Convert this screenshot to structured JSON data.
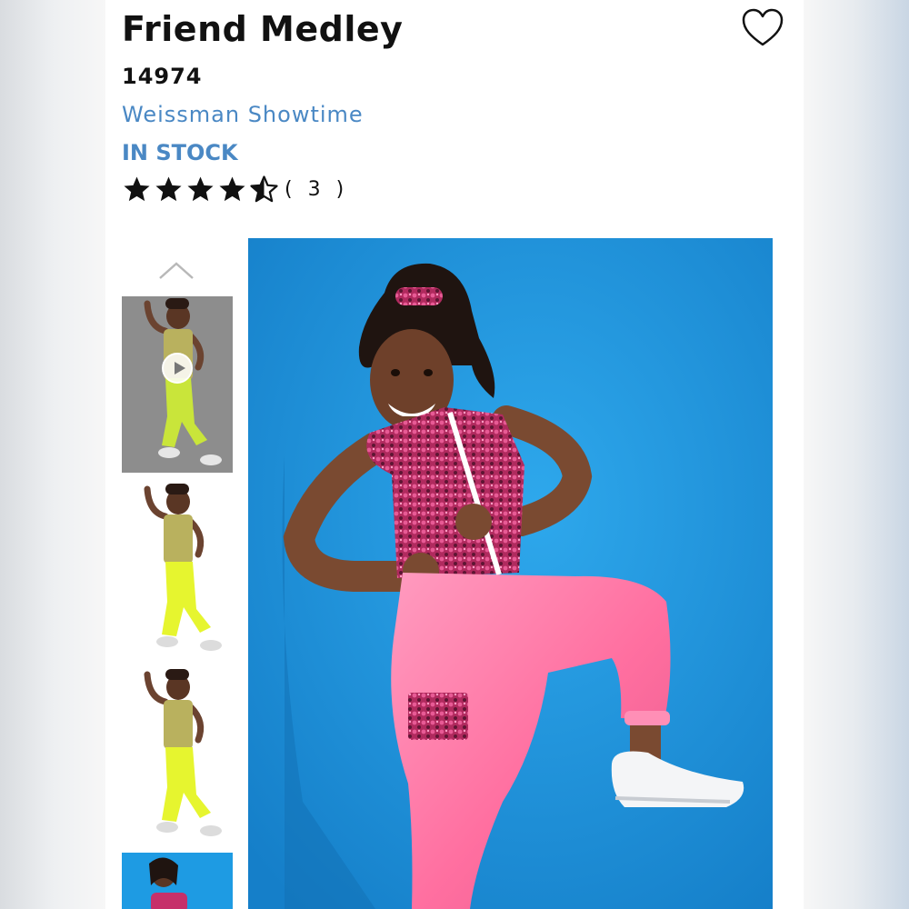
{
  "product": {
    "title": "Friend Medley",
    "sku": "14974",
    "brand": "Weissman Showtime",
    "stock_status": "IN STOCK",
    "rating": 4.5,
    "rating_max": 5,
    "review_count": "( 3 )"
  },
  "icons": {
    "favorite": "heart-outline-icon",
    "gallery_up": "chevron-up-icon",
    "video": "play-icon",
    "star": "star-icon"
  },
  "gallery": {
    "thumbnails": [
      {
        "kind": "video",
        "background": "#8d8d8d",
        "top": "#b9b15e",
        "pants": "#c9e53a"
      },
      {
        "kind": "image",
        "background": "#ffffff",
        "top": "#b9b15e",
        "pants": "#e6f52f"
      },
      {
        "kind": "image",
        "background": "#ffffff",
        "top": "#b9b15e",
        "pants": "#e6f52f"
      },
      {
        "kind": "image",
        "background": "#1e9be3",
        "top": "#c6306a",
        "pants": "#ff7aa8"
      }
    ],
    "main_image_background": "#1e9be3"
  },
  "colors": {
    "brand_link": "#4a88c4",
    "stock": "#4a88c4",
    "text": "#111111",
    "costume_pink": "#ff7aa8",
    "sequin": "#c6306a",
    "neon_yellow": "#e6f52f"
  }
}
